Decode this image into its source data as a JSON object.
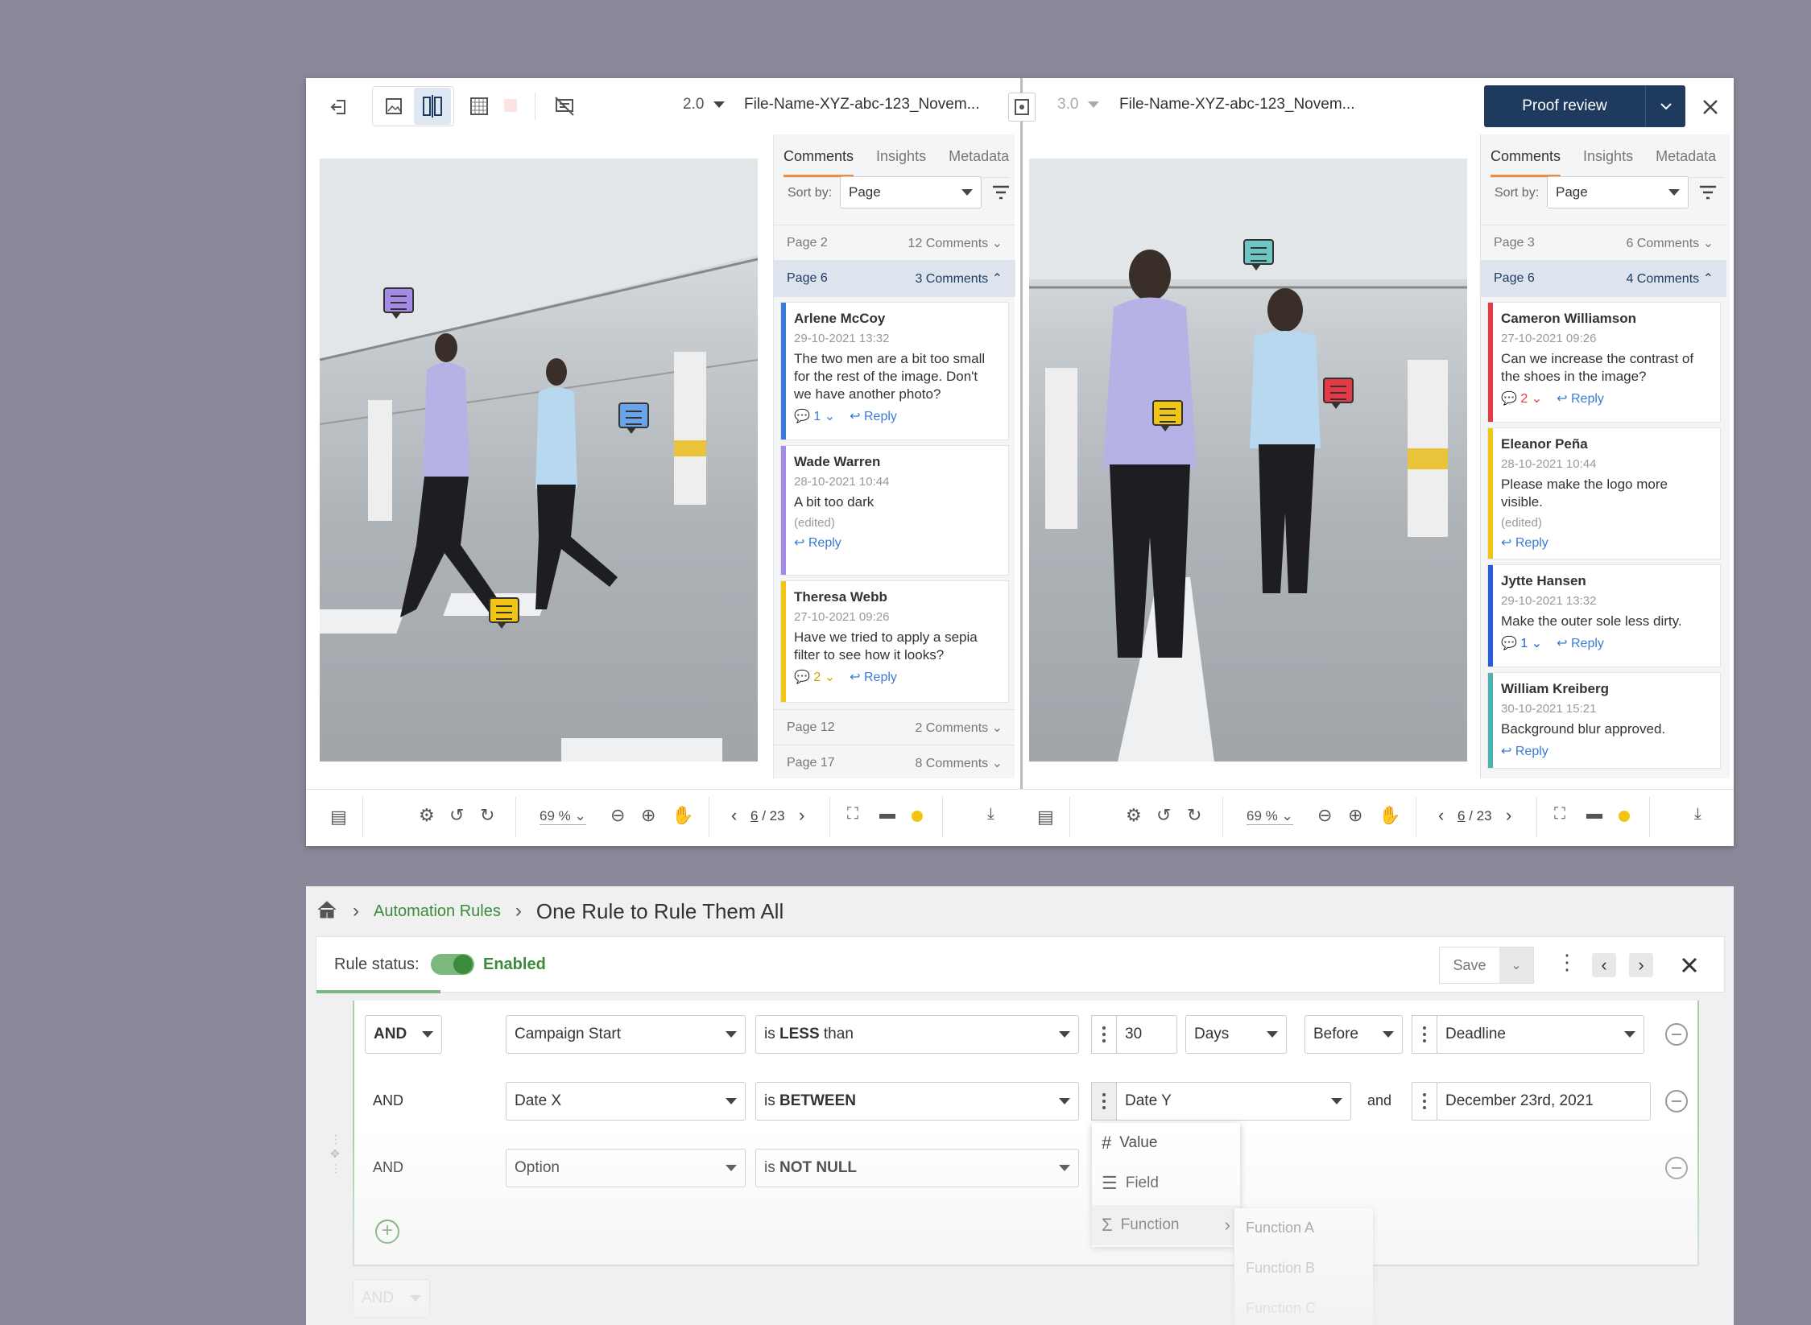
{
  "viewer": {
    "left_version": "2.0",
    "right_version": "3.0",
    "left_filename": "File-Name-XYZ-abc-123_Novem...",
    "right_filename": "File-Name-XYZ-abc-123_Novem...",
    "proof_button": "Proof review",
    "tabs": [
      "Comments",
      "Insights",
      "Metadata"
    ],
    "sort_label": "Sort by:",
    "sort_value": "Page",
    "left_panel": {
      "groups_top": [
        {
          "page": "Page 2",
          "count": "12 Comments"
        }
      ],
      "active_group": {
        "page": "Page 6",
        "count": "3 Comments"
      },
      "comments": [
        {
          "name": "Arlene McCoy",
          "date": "29-10-2021 13:32",
          "text": "The two men are a bit too small for the rest of the image. Don't we have another photo?",
          "replies": "1",
          "reply": "Reply",
          "color": "#3a7bd5"
        },
        {
          "name": "Wade Warren",
          "date": "28-10-2021 10:44",
          "text": "A bit too dark",
          "edited": "(edited)",
          "reply": "Reply",
          "color": "#a48be6"
        },
        {
          "name": "Theresa Webb",
          "date": "27-10-2021 09:26",
          "text": "Have we tried to apply a sepia filter to see how it looks?",
          "replies": "2",
          "reply": "Reply",
          "color": "#f2c515"
        }
      ],
      "groups_bottom": [
        {
          "page": "Page 12",
          "count": "2 Comments"
        },
        {
          "page": "Page 17",
          "count": "8 Comments"
        }
      ]
    },
    "right_panel": {
      "groups_top": [
        {
          "page": "Page 3",
          "count": "6 Comments"
        }
      ],
      "active_group": {
        "page": "Page 6",
        "count": "4 Comments"
      },
      "comments": [
        {
          "name": "Cameron Williamson",
          "date": "27-10-2021 09:26",
          "text": "Can we increase the contrast of the shoes in the image?",
          "replies": "2",
          "reply": "Reply",
          "color": "#e63946"
        },
        {
          "name": "Eleanor Peña",
          "date": "28-10-2021 10:44",
          "text": "Please make the logo more visible.",
          "edited": "(edited)",
          "reply": "Reply",
          "color": "#f2c515"
        },
        {
          "name": "Jytte Hansen",
          "date": "29-10-2021 13:32",
          "text": "Make the outer sole less dirty.",
          "replies": "1",
          "reply": "Reply",
          "color": "#2a5bd7"
        },
        {
          "name": "William Kreiberg",
          "date": "30-10-2021 15:21",
          "text": "Background blur approved.",
          "reply": "Reply",
          "color": "#4fb3b0"
        }
      ]
    },
    "toolbar": {
      "zoom": "69 %",
      "page_current": "6",
      "page_sep": "/ 23"
    }
  },
  "rules": {
    "breadcrumb_link": "Automation Rules",
    "breadcrumb_current": "One Rule to Rule Them All",
    "status_label": "Rule status:",
    "status_value": "Enabled",
    "save": "Save",
    "rows": [
      {
        "logic": "AND",
        "field": "Campaign Start",
        "op_prefix": "is ",
        "op": "LESS",
        "op_suffix": " than",
        "value": "30",
        "unit": "Days",
        "when": "Before",
        "target": "Deadline"
      },
      {
        "logic": "AND",
        "field": "Date X",
        "op_prefix": "is ",
        "op": "BETWEEN",
        "op_suffix": "",
        "value": "Date Y",
        "and": "and",
        "target": "December 23rd, 2021"
      },
      {
        "logic": "AND",
        "field": "Option",
        "op_prefix": "is ",
        "op": "NOT NULL",
        "op_suffix": ""
      }
    ],
    "menu": [
      "Value",
      "Field",
      "Function"
    ],
    "submenu": [
      "Function A",
      "Function B",
      "Function C"
    ],
    "bottom_logic": "AND"
  },
  "colors": {
    "accent": "#f08a3c",
    "navy": "#1e3a5f",
    "green": "#3c8a3c"
  }
}
